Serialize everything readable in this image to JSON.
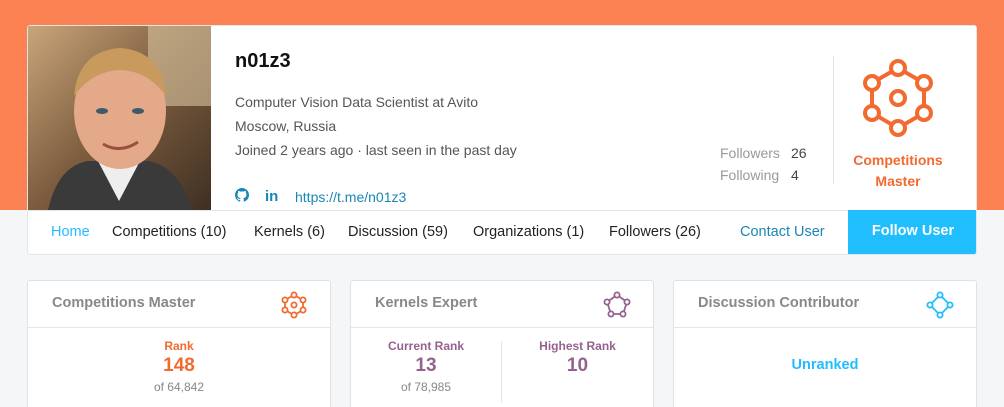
{
  "profile": {
    "username": "n01z3",
    "bio": "Computer Vision Data Scientist at Avito",
    "location": "Moscow, Russia",
    "joined": "Joined 2 years ago · last seen in the past day",
    "link": "https://t.me/n01z3",
    "followers_label": "Followers",
    "followers_count": "26",
    "following_label": "Following",
    "following_count": "4",
    "tier": "Competitions Master",
    "tier_color": "#f26a2f"
  },
  "nav": {
    "tabs": [
      {
        "label": "Home"
      },
      {
        "label": "Competitions (10)"
      },
      {
        "label": "Kernels (6)"
      },
      {
        "label": "Discussion (59)"
      },
      {
        "label": "Organizations (1)"
      },
      {
        "label": "Followers (26)"
      }
    ],
    "contact": "Contact User",
    "follow": "Follow User"
  },
  "panels": {
    "competitions": {
      "title": "Competitions Master",
      "icon": "competitions-master-icon",
      "color": "#f26a2f",
      "rank_label": "Rank",
      "rank": "148",
      "of": "of 64,842"
    },
    "kernels": {
      "title": "Kernels Expert",
      "icon": "kernels-expert-icon",
      "color": "#95628f",
      "current_label": "Current Rank",
      "current": "13",
      "of": "of 78,985",
      "highest_label": "Highest Rank",
      "highest": "10"
    },
    "discussion": {
      "title": "Discussion Contributor",
      "icon": "discussion-contributor-icon",
      "color": "#20beff",
      "status": "Unranked"
    }
  }
}
